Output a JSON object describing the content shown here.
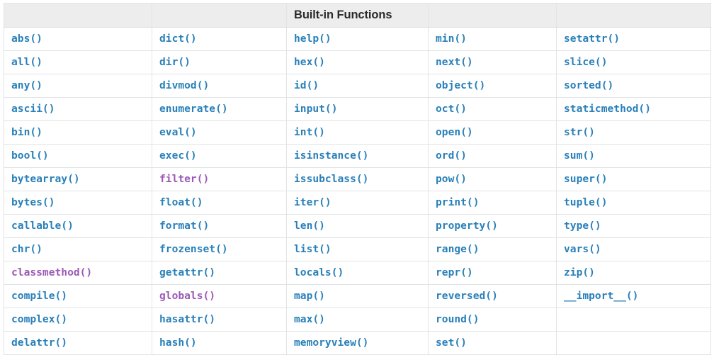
{
  "table": {
    "title": "Built-in Functions",
    "title_column_index": 2,
    "column_count": 5,
    "row_count": 14,
    "colors": {
      "link": "#2980b9",
      "visited": "#9b59b6",
      "header_background": "#ededed",
      "header_text": "#2a2a2a",
      "border": "#e1e4e5",
      "cell_background": "#ffffff"
    },
    "header_cells": [
      "",
      "",
      "Built-in Functions",
      "",
      ""
    ],
    "rows": [
      [
        {
          "label": "abs()",
          "state": "link"
        },
        {
          "label": "dict()",
          "state": "link"
        },
        {
          "label": "help()",
          "state": "link"
        },
        {
          "label": "min()",
          "state": "link"
        },
        {
          "label": "setattr()",
          "state": "link"
        }
      ],
      [
        {
          "label": "all()",
          "state": "link"
        },
        {
          "label": "dir()",
          "state": "link"
        },
        {
          "label": "hex()",
          "state": "link"
        },
        {
          "label": "next()",
          "state": "link"
        },
        {
          "label": "slice()",
          "state": "link"
        }
      ],
      [
        {
          "label": "any()",
          "state": "link"
        },
        {
          "label": "divmod()",
          "state": "link"
        },
        {
          "label": "id()",
          "state": "link"
        },
        {
          "label": "object()",
          "state": "link"
        },
        {
          "label": "sorted()",
          "state": "link"
        }
      ],
      [
        {
          "label": "ascii()",
          "state": "link"
        },
        {
          "label": "enumerate()",
          "state": "link"
        },
        {
          "label": "input()",
          "state": "link"
        },
        {
          "label": "oct()",
          "state": "link"
        },
        {
          "label": "staticmethod()",
          "state": "link"
        }
      ],
      [
        {
          "label": "bin()",
          "state": "link"
        },
        {
          "label": "eval()",
          "state": "link"
        },
        {
          "label": "int()",
          "state": "link"
        },
        {
          "label": "open()",
          "state": "link"
        },
        {
          "label": "str()",
          "state": "link"
        }
      ],
      [
        {
          "label": "bool()",
          "state": "link"
        },
        {
          "label": "exec()",
          "state": "link"
        },
        {
          "label": "isinstance()",
          "state": "link"
        },
        {
          "label": "ord()",
          "state": "link"
        },
        {
          "label": "sum()",
          "state": "link"
        }
      ],
      [
        {
          "label": "bytearray()",
          "state": "link"
        },
        {
          "label": "filter()",
          "state": "visited"
        },
        {
          "label": "issubclass()",
          "state": "link"
        },
        {
          "label": "pow()",
          "state": "link"
        },
        {
          "label": "super()",
          "state": "link"
        }
      ],
      [
        {
          "label": "bytes()",
          "state": "link"
        },
        {
          "label": "float()",
          "state": "link"
        },
        {
          "label": "iter()",
          "state": "link"
        },
        {
          "label": "print()",
          "state": "link"
        },
        {
          "label": "tuple()",
          "state": "link"
        }
      ],
      [
        {
          "label": "callable()",
          "state": "link"
        },
        {
          "label": "format()",
          "state": "link"
        },
        {
          "label": "len()",
          "state": "link"
        },
        {
          "label": "property()",
          "state": "link"
        },
        {
          "label": "type()",
          "state": "link"
        }
      ],
      [
        {
          "label": "chr()",
          "state": "link"
        },
        {
          "label": "frozenset()",
          "state": "link"
        },
        {
          "label": "list()",
          "state": "link"
        },
        {
          "label": "range()",
          "state": "link"
        },
        {
          "label": "vars()",
          "state": "link"
        }
      ],
      [
        {
          "label": "classmethod()",
          "state": "visited"
        },
        {
          "label": "getattr()",
          "state": "link"
        },
        {
          "label": "locals()",
          "state": "link"
        },
        {
          "label": "repr()",
          "state": "link"
        },
        {
          "label": "zip()",
          "state": "link"
        }
      ],
      [
        {
          "label": "compile()",
          "state": "link"
        },
        {
          "label": "globals()",
          "state": "visited"
        },
        {
          "label": "map()",
          "state": "link"
        },
        {
          "label": "reversed()",
          "state": "link"
        },
        {
          "label": "__import__()",
          "state": "link"
        }
      ],
      [
        {
          "label": "complex()",
          "state": "link"
        },
        {
          "label": "hasattr()",
          "state": "link"
        },
        {
          "label": "max()",
          "state": "link"
        },
        {
          "label": "round()",
          "state": "link"
        },
        {
          "label": "",
          "state": "empty"
        }
      ],
      [
        {
          "label": "delattr()",
          "state": "link"
        },
        {
          "label": "hash()",
          "state": "link"
        },
        {
          "label": "memoryview()",
          "state": "link"
        },
        {
          "label": "set()",
          "state": "link"
        },
        {
          "label": "",
          "state": "empty"
        }
      ]
    ]
  }
}
